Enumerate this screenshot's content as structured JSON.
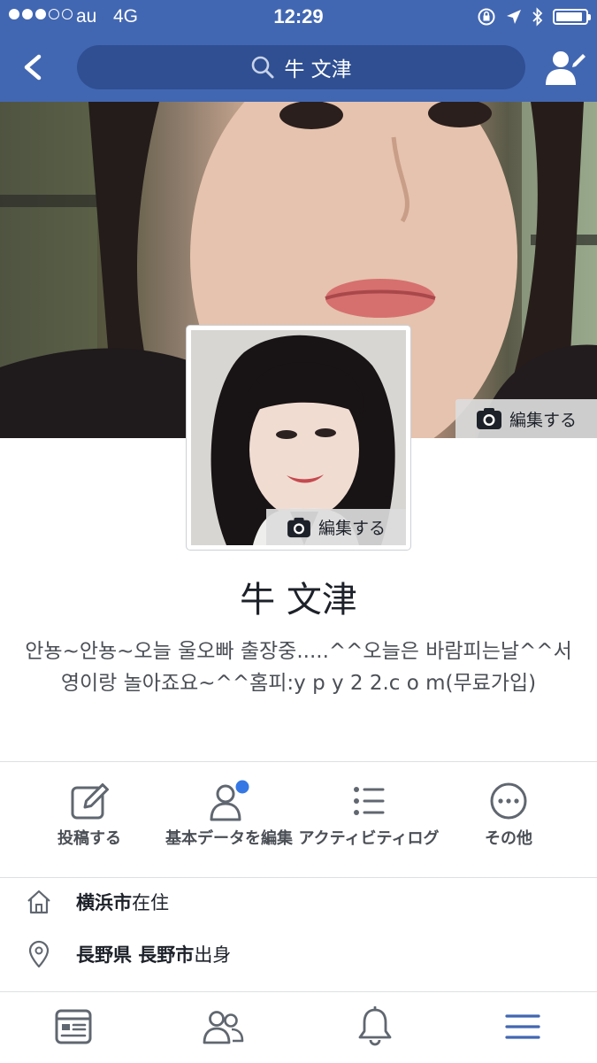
{
  "status_bar": {
    "carrier": "au",
    "network": "4G",
    "time": "12:29",
    "battery_level": 0.9
  },
  "nav": {
    "back_icon": "chevron-left-icon",
    "search_query": "牛 文津",
    "right_icon": "profile-edit-icon"
  },
  "cover": {
    "edit_label": "編集する"
  },
  "avatar": {
    "edit_label": "編集する"
  },
  "profile": {
    "name": "牛 文津",
    "bio": "안뇽~안뇽~오늘 울오빠 출장중.....^^오늘은 바람피는날^^서영이랑 놀아죠요~^^홈피:y p y 2 2.c o m(무료가입)"
  },
  "actions": [
    {
      "label": "投稿する",
      "icon": "compose-icon"
    },
    {
      "label": "基本データを編集",
      "icon": "user-info-icon",
      "badge": true
    },
    {
      "label": "アクティビティログ",
      "icon": "list-icon"
    },
    {
      "label": "その他",
      "icon": "more-icon"
    }
  ],
  "info": {
    "residence": {
      "place": "横浜市",
      "suffix": "在住",
      "icon": "home-icon"
    },
    "hometown": {
      "place": "長野県 長野市",
      "suffix": "出身",
      "icon": "location-pin-icon"
    }
  },
  "tabs": [
    {
      "name": "news-feed",
      "icon": "news-feed-icon"
    },
    {
      "name": "friends",
      "icon": "friends-icon"
    },
    {
      "name": "notifications",
      "icon": "bell-icon"
    },
    {
      "name": "menu",
      "icon": "menu-icon",
      "active": true
    }
  ],
  "colors": {
    "brand_blue": "#4267b2",
    "search_bg": "#2f4f92",
    "badge_blue": "#3578e5",
    "active_tab": "#4267b2",
    "icon_gray": "#606770"
  }
}
